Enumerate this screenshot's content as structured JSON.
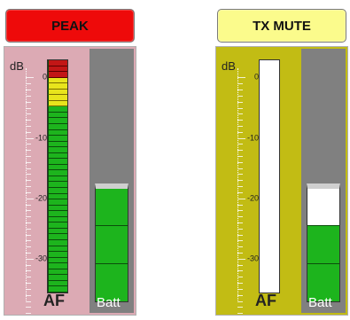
{
  "left_channel": {
    "status_label": "PEAK",
    "status_color": "#ee0a0a",
    "panel_color": "#dcaab4",
    "unit_label": "dB",
    "scale_labels": [
      "0",
      "-10",
      "-20",
      "-30"
    ],
    "af_label": "AF",
    "af_level_fraction": 1.0,
    "battery_label": "Batt",
    "battery_level_fraction": 1.0
  },
  "right_channel": {
    "status_label": "TX MUTE",
    "status_color": "#fbfb8c",
    "panel_color": "#c2bc14",
    "unit_label": "dB",
    "scale_labels": [
      "0",
      "-10",
      "-20",
      "-30"
    ],
    "af_label": "AF",
    "af_level_fraction": 0.0,
    "battery_label": "Batt",
    "battery_level_fraction": 0.67
  },
  "colors": {
    "meter_green": "#1db41d",
    "meter_yellow": "#e8e41c",
    "meter_red": "#c21616",
    "battery_column": "#808080"
  }
}
